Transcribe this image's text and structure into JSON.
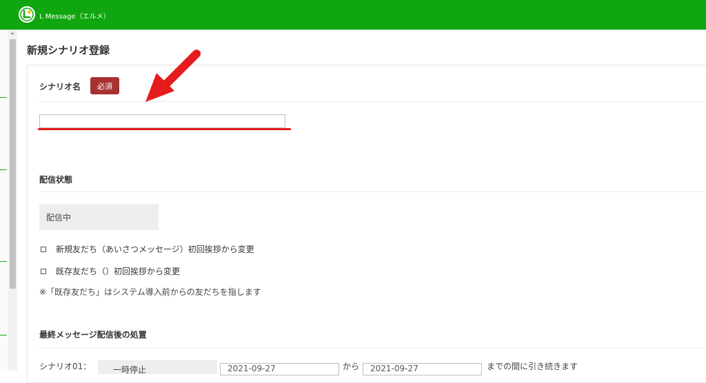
{
  "header": {
    "app_title": "L Message（エルメ）",
    "bg_color": "#0fa60f",
    "logo_icon": "lmessage-logo-icon"
  },
  "page": {
    "title": "新規シナリオ登録"
  },
  "scenario_name": {
    "label": "シナリオ名",
    "required_badge": "必須",
    "value": "",
    "placeholder": ""
  },
  "delivery_status": {
    "label": "配信状態",
    "current": "配信中",
    "options": [
      {
        "label": "新規友だち（あいさつメッセージ）初回挨拶から変更",
        "checked": false
      },
      {
        "label": "既存友だち（）初回挨拶から変更",
        "checked": false
      }
    ],
    "note": "※「既存友だち」はシステム導入前からの友だちを指します"
  },
  "final_action": {
    "label": "最終メッセージ配信後の処置",
    "row_label": "シナリオ01：",
    "mode": "一時停止",
    "date_from": "2021-09-27",
    "connector": "から",
    "date_to": "2021-09-27",
    "suffix": "までの間に引き続きます"
  },
  "annotation": {
    "arrow_color": "#e61c1c"
  }
}
